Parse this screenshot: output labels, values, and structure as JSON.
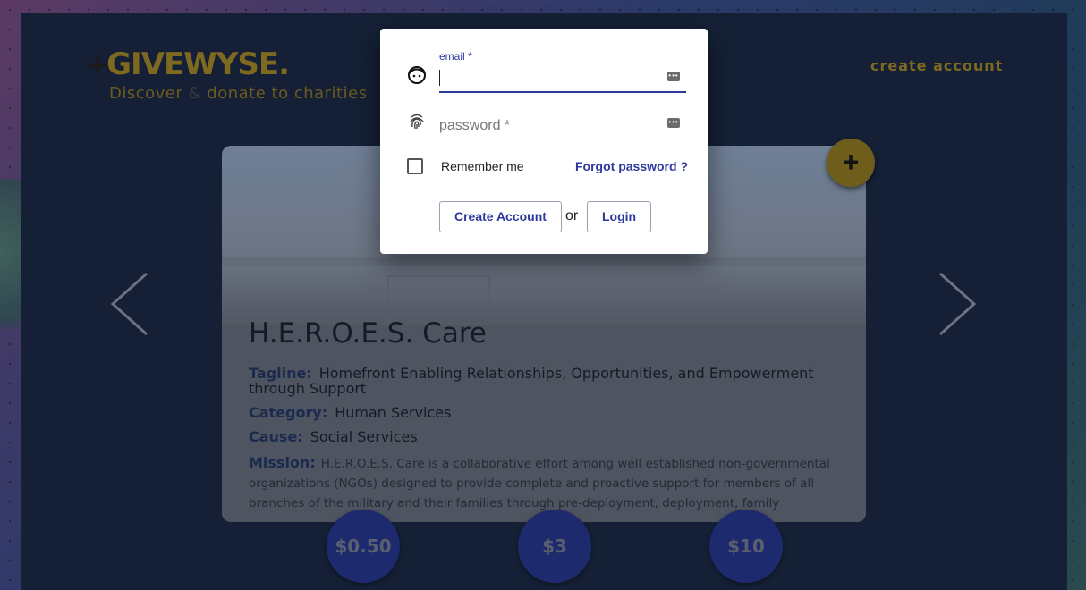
{
  "header": {
    "logo_text": "GIVEWYSE",
    "tagline_part1": "Discover",
    "tagline_amp": "&",
    "tagline_part2": "donate to charities",
    "create_account_link": "create account"
  },
  "charity": {
    "name": "H.E.R.O.E.S. Care",
    "tagline_label": "Tagline:",
    "tagline_value": "Homefront Enabling Relationships, Opportunities, and Empowerment through Support",
    "category_label": "Category:",
    "category_value": "Human Services",
    "cause_label": "Cause:",
    "cause_value": "Social Services",
    "mission_label": "Mission:",
    "mission_value": "H.E.R.O.E.S. Care is a collaborative effort among well established non-governmental organizations (NGOs) designed to provide complete and proactive support for members of all branches of the military and their families through pre-deployment, deployment, family"
  },
  "fab": {
    "icon": "plus-icon",
    "glyph": "+"
  },
  "donation_amounts": [
    "$0.50",
    "$3",
    "$10"
  ],
  "login_dialog": {
    "email_label": "email *",
    "email_value": "",
    "password_placeholder": "password *",
    "remember_me": "Remember me",
    "forgot_password": "Forgot password ?",
    "create_account_button": "Create Account",
    "or_text": "or",
    "login_button": "Login",
    "accent_color": "#2d3a9c"
  }
}
